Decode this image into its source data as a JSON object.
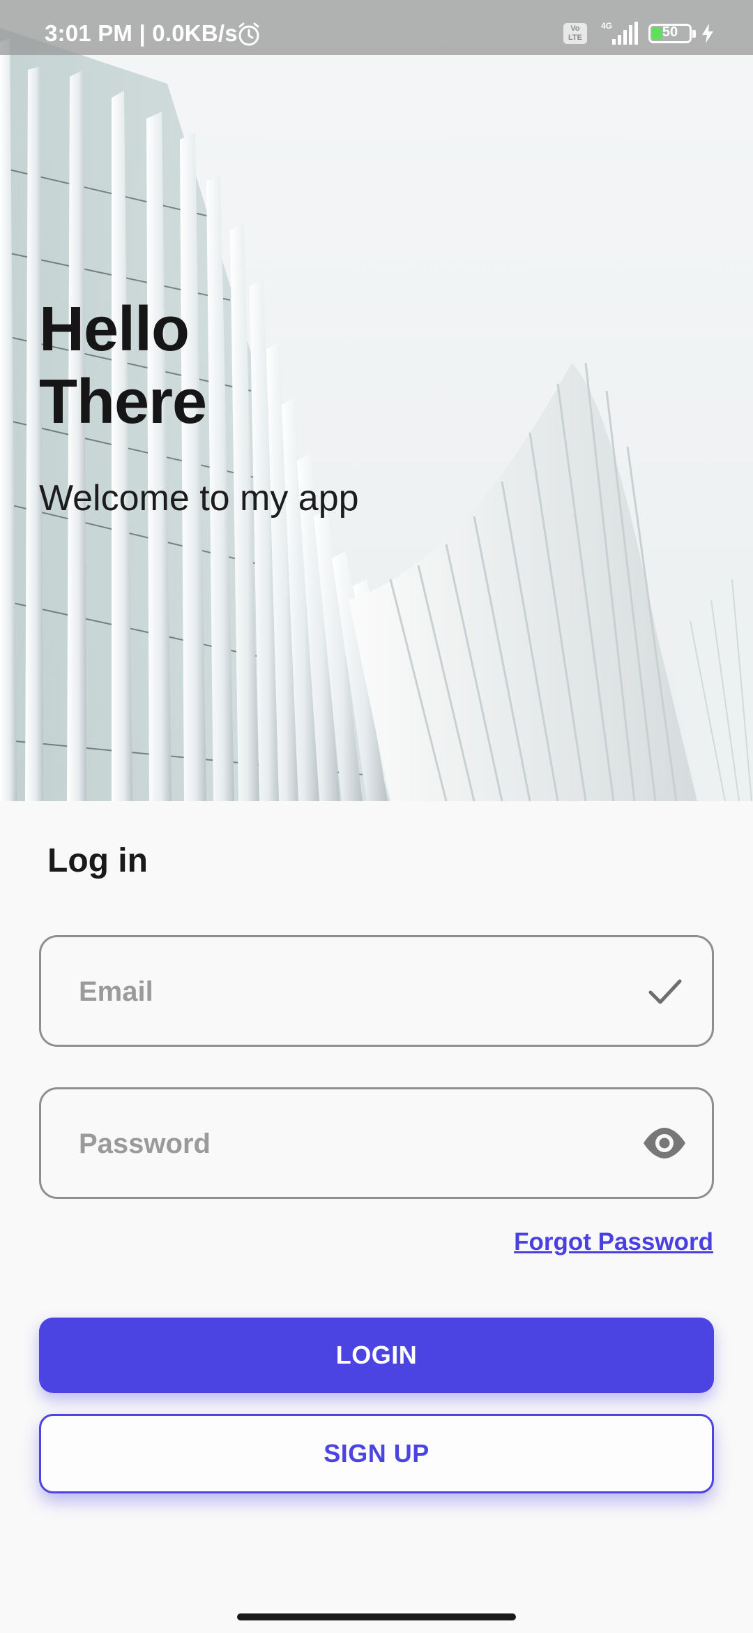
{
  "status_bar": {
    "time": "3:01 PM | 0.0KB/s",
    "volte": "Vo LTE",
    "network": "4G",
    "battery_level": "50",
    "icons": [
      "alarm-icon",
      "volte-icon",
      "signal-icon",
      "battery-icon",
      "charging-icon"
    ]
  },
  "hero": {
    "title_line1": "Hello",
    "title_line2": "There",
    "subtitle": "Welcome to my app"
  },
  "login": {
    "heading": "Log in",
    "email": {
      "placeholder": "Email",
      "value": "",
      "trailing_icon": "check-icon"
    },
    "password": {
      "placeholder": "Password",
      "value": "",
      "trailing_icon": "eye-icon"
    },
    "forgot_password": "Forgot Password",
    "login_button": "LOGIN",
    "signup_button": "SIGN UP"
  },
  "colors": {
    "accent": "#4c43e3",
    "text_dark": "#161616",
    "field_border": "#8f8f8f",
    "background": "#f9f9f9"
  }
}
